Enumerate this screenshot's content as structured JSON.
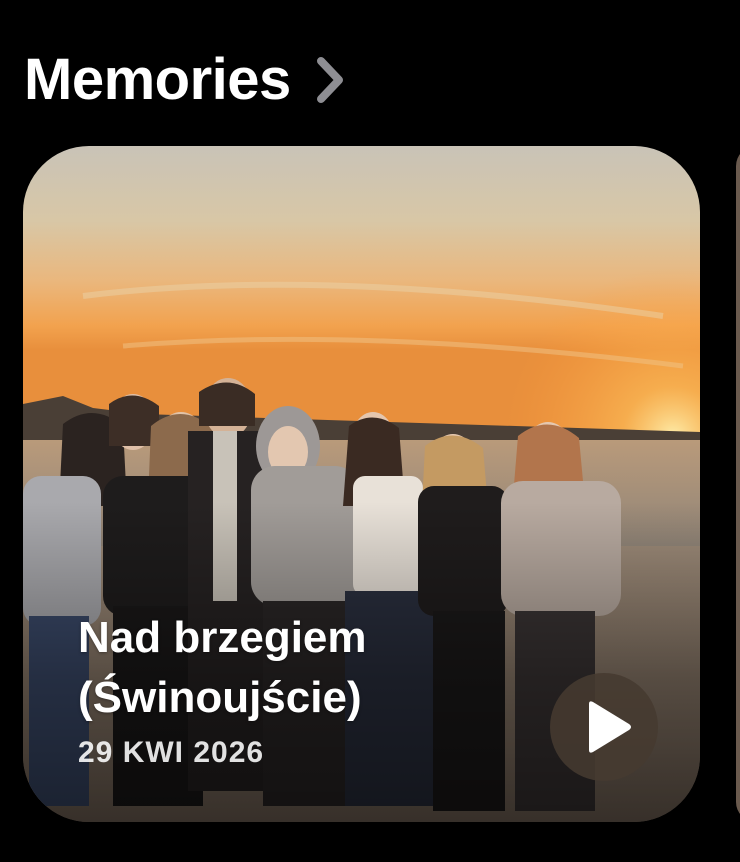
{
  "header": {
    "title": "Memories",
    "chevron_icon": "chevron-right-icon"
  },
  "memory": {
    "title": "Nad brzegiem\n(Świnoujście)",
    "date": "29 KWI 2026",
    "play_icon": "play-icon",
    "image_description_visible": false
  },
  "colors": {
    "background": "#000000",
    "text": "#ffffff",
    "chevron": "#8e8e93",
    "play_button_bg": "#463a30"
  }
}
